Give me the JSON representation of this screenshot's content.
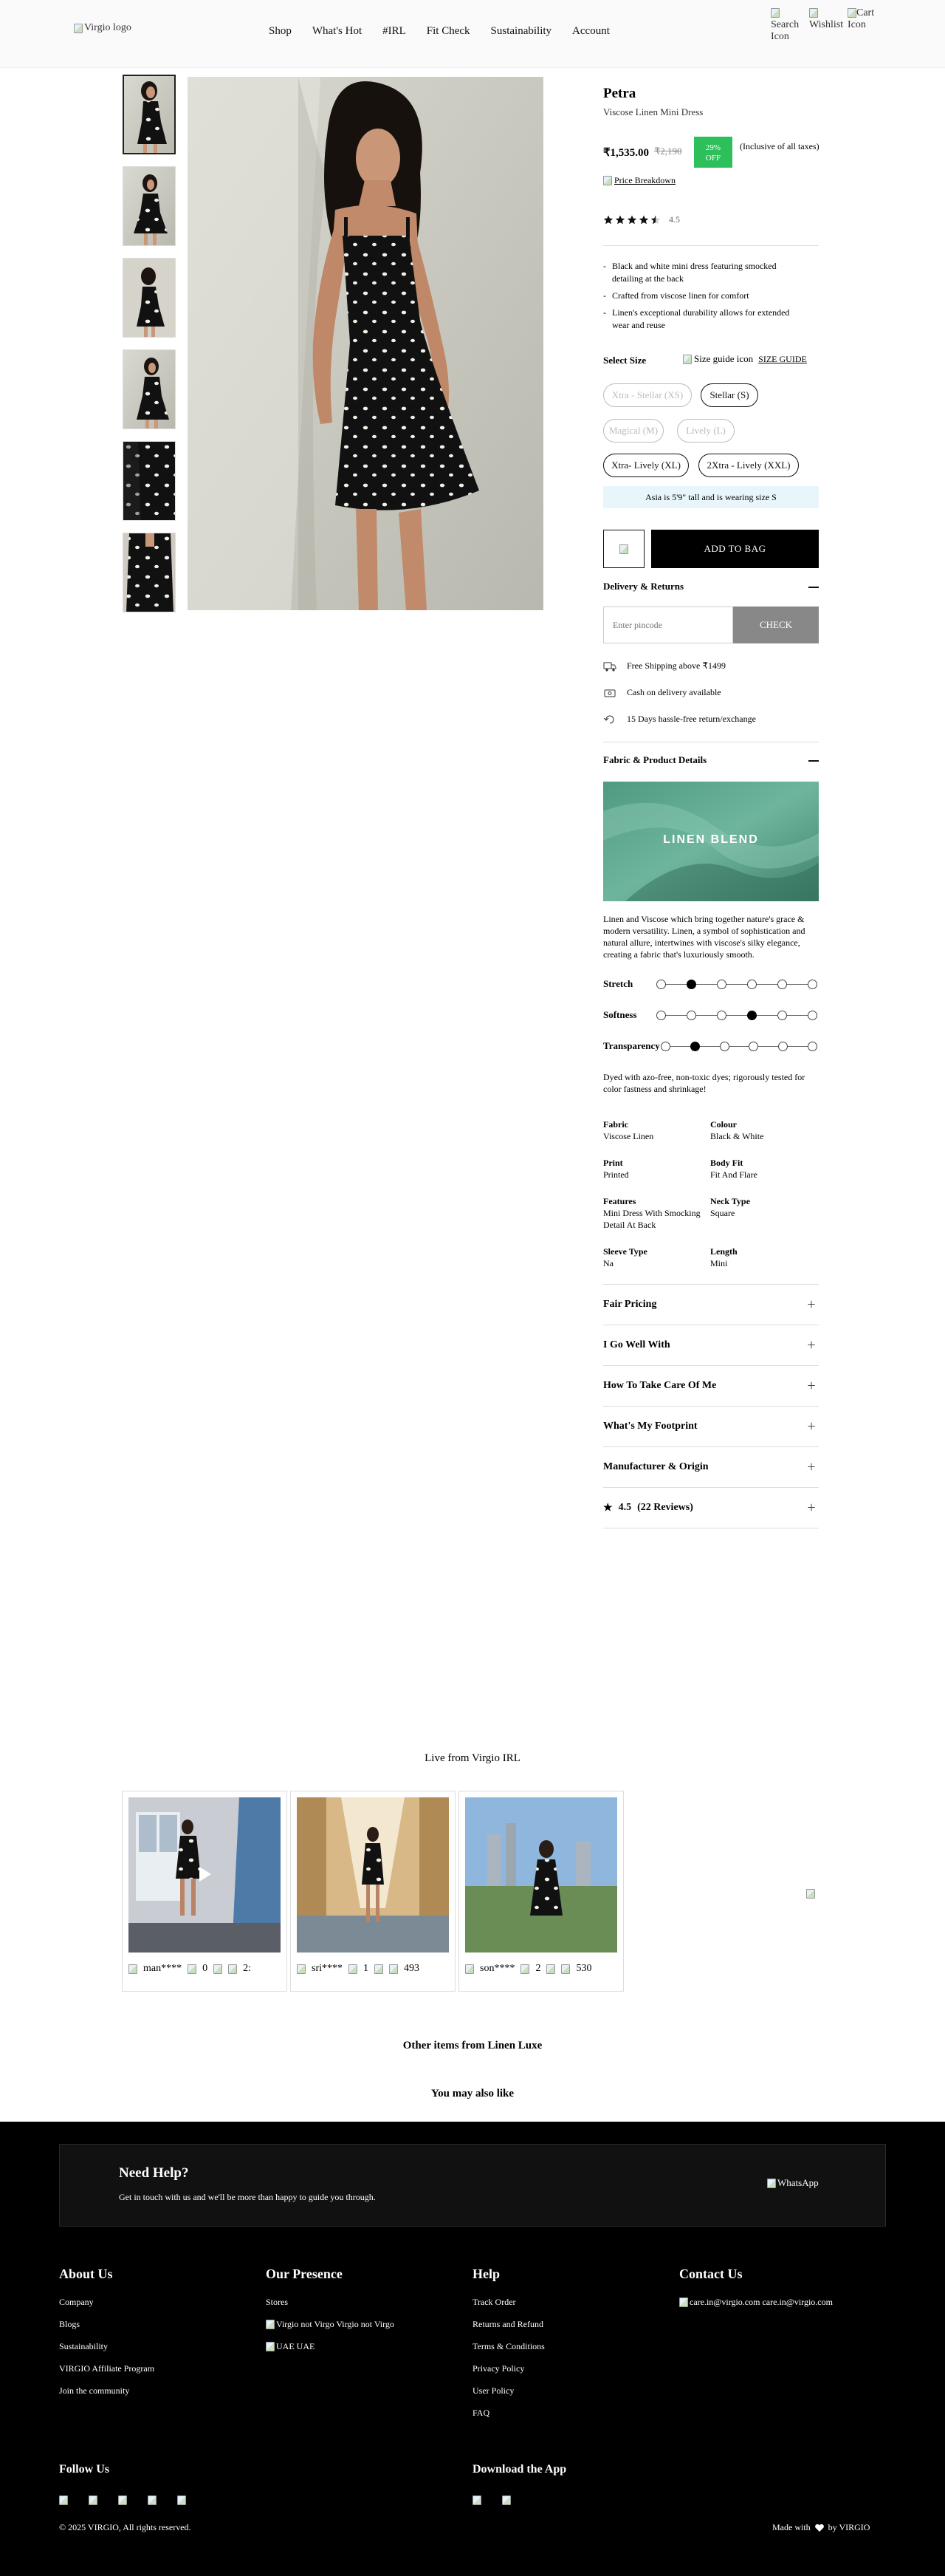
{
  "header": {
    "logo_alt": "Virgio logo",
    "nav": [
      "Shop",
      "What's Hot",
      "#IRL",
      "Fit Check",
      "Sustainability",
      "Account"
    ],
    "icons": [
      {
        "label": "Search Icon",
        "icon": "search-icon"
      },
      {
        "label": "Wishlist",
        "icon": "wishlist-icon"
      },
      {
        "label": "Cart Icon",
        "icon": "cart-icon"
      }
    ]
  },
  "product": {
    "name": "Petra",
    "subtitle": "Viscose Linen Mini Dress",
    "price": "₹1,535.00",
    "mrp": "₹2,190",
    "discount_line1": "29%",
    "discount_line2": "OFF",
    "tax_note": "(Inclusive of all taxes)",
    "price_breakdown": "Price Breakdown",
    "rating": 4.5,
    "rating_text": "4.5",
    "highlights": [
      "Black and white mini dress featuring smocked detailing at the back",
      "Crafted from viscose linen for comfort",
      "Linen's exceptional durability allows for extended wear and reuse"
    ],
    "select_size_label": "Select Size",
    "size_guide_icon_alt": "Size guide icon",
    "size_guide_label": "SIZE GUIDE",
    "sizes": [
      {
        "label": "Xtra - Stellar (XS)",
        "available": false
      },
      {
        "label": "Stellar (S)",
        "available": true
      },
      {
        "label": "Magical (M)",
        "available": false
      },
      {
        "label": "Lively (L)",
        "available": false
      },
      {
        "label": "Xtra- Lively (XL)",
        "available": true
      },
      {
        "label": "2Xtra - Lively (XXL)",
        "available": true
      }
    ],
    "model_note": "Asia is 5'9\" tall and is wearing size S",
    "add_to_bag": "ADD TO BAG"
  },
  "delivery": {
    "title": "Delivery & Returns",
    "pincode_placeholder": "Enter pincode",
    "check_label": "CHECK",
    "perks": [
      {
        "icon": "truck-icon",
        "text": "Free Shipping above ₹1499"
      },
      {
        "icon": "cash-icon",
        "text": "Cash on delivery available"
      },
      {
        "icon": "return-icon",
        "text": "15 Days hassle-free return/exchange"
      }
    ]
  },
  "fabric": {
    "title": "Fabric & Product Details",
    "banner_text": "LINEN BLEND",
    "description": "Linen and Viscose which bring together nature's grace & modern versatility. Linen, a symbol of sophistication and natural allure, intertwines with viscose's silky elegance, creating a fabric that's luxuriously smooth.",
    "scales": [
      {
        "label": "Stretch",
        "level": 2,
        "steps": 6
      },
      {
        "label": "Softness",
        "level": 4,
        "steps": 6
      },
      {
        "label": "Transparency",
        "level": 2,
        "steps": 6
      }
    ],
    "dye_note": "Dyed with azo-free, non-toxic dyes; rigorously tested for color fastness and shrinkage!",
    "specs": [
      {
        "k": "Fabric",
        "v": "Viscose Linen"
      },
      {
        "k": "Colour",
        "v": "Black & White"
      },
      {
        "k": "Print",
        "v": "Printed"
      },
      {
        "k": "Body Fit",
        "v": "Fit And Flare"
      },
      {
        "k": "Features",
        "v": "Mini Dress With Smocking Detail At Back"
      },
      {
        "k": "Neck Type",
        "v": "Square"
      },
      {
        "k": "Sleeve Type",
        "v": "Na"
      },
      {
        "k": "Length",
        "v": "Mini"
      }
    ]
  },
  "accordions": [
    "Fair Pricing",
    "I Go Well With",
    "How To Take Care Of Me",
    "What's My Footprint",
    "Manufacturer & Origin"
  ],
  "reviews_acc": {
    "rating": "4.5",
    "count": "(22 Reviews)"
  },
  "irl": {
    "title": "Live from Virgio IRL",
    "reels": [
      {
        "user": "man****",
        "likes": "0",
        "views": "2:"
      },
      {
        "user": "sri****",
        "likes": "1",
        "views": "493"
      },
      {
        "user": "son****",
        "likes": "2",
        "views": "530"
      }
    ]
  },
  "sections": {
    "other_items": "Other items from Linen Luxe",
    "you_may_like": "You may also like"
  },
  "footer": {
    "help_title": "Need Help?",
    "help_text": "Get in touch with us and we'll be more than happy to guide you through.",
    "whatsapp_alt": "WhatsApp",
    "about_title": "About Us",
    "about": [
      "Company",
      "Blogs",
      "Sustainability",
      "VIRGIO Affiliate Program",
      "Join the community"
    ],
    "presence_title": "Our Presence",
    "presence": [
      "Stores",
      "Virgio not Virgo  Virgio not Virgo",
      "UAE  UAE"
    ],
    "help_col_title": "Help",
    "help_links": [
      "Track Order",
      "Returns and Refund",
      "Terms & Conditions",
      "Privacy Policy",
      "User Policy",
      "FAQ"
    ],
    "contact_title": "Contact Us",
    "contact": "care.in@virgio.com  care.in@virgio.com",
    "follow_title": "Follow Us",
    "download_title": "Download the App",
    "copyright": "© 2025 VIRGIO, All rights reserved.",
    "made_with": "Made with",
    "by": "by VIRGIO"
  }
}
